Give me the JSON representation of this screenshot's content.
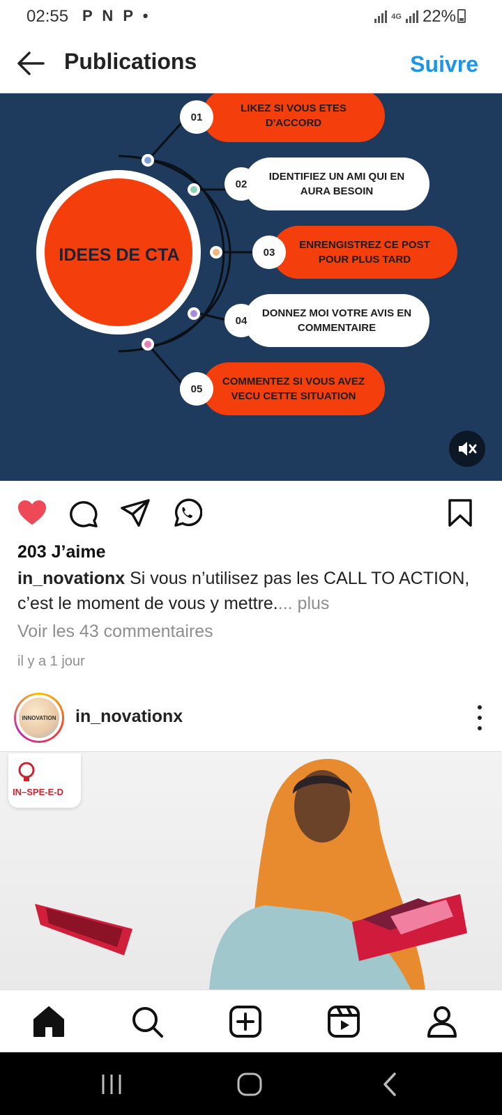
{
  "status_bar": {
    "time": "02:55",
    "app_icons": "P N P •",
    "network": "4G",
    "battery": "22%"
  },
  "header": {
    "title": "Publications",
    "follow_label": "Suivre"
  },
  "post": {
    "infographic": {
      "center_label": "IDEES DE CTA",
      "items": [
        {
          "number": "01",
          "text": "LIKEZ SI VOUS ETES D'ACCORD"
        },
        {
          "number": "02",
          "text": "IDENTIFIEZ UN AMI QUI EN AURA BESOIN"
        },
        {
          "number": "03",
          "text": "ENRENGISTREZ  CE POST POUR PLUS TARD"
        },
        {
          "number": "04",
          "text": "DONNEZ MOI VOTRE AVIS EN COMMENTAIRE"
        },
        {
          "number": "05",
          "text": "COMMENTEZ SI VOUS AVEZ VECU CETTE SITUATION"
        }
      ]
    },
    "likes": "203 J’aime",
    "caption_user": "in_novationx",
    "caption_text": " Si vous n’utilisez pas les CALL TO ACTION, c’est le moment de vous y mettre.",
    "caption_more": "... plus",
    "comments_link": "Voir les 43 commentaires",
    "timestamp": "il y a 1 jour"
  },
  "next_post": {
    "username": "in_novationx",
    "avatar_text": "INNOVATION",
    "brand_badge": "IN–SPE-E-D"
  },
  "colors": {
    "accent": "#1c96e8",
    "infographic_bg": "#1e3a5c",
    "cta_orange": "#f43f0c",
    "like_red": "#ed4956"
  },
  "icons": {
    "actions": [
      "heart-icon",
      "comment-icon",
      "share-icon",
      "whatsapp-icon",
      "bookmark-icon"
    ],
    "bottom_nav": [
      "home-icon",
      "search-icon",
      "create-icon",
      "reels-icon",
      "profile-icon"
    ],
    "system_nav": [
      "recents-icon",
      "home-circle-icon",
      "back-chevron-icon"
    ]
  }
}
